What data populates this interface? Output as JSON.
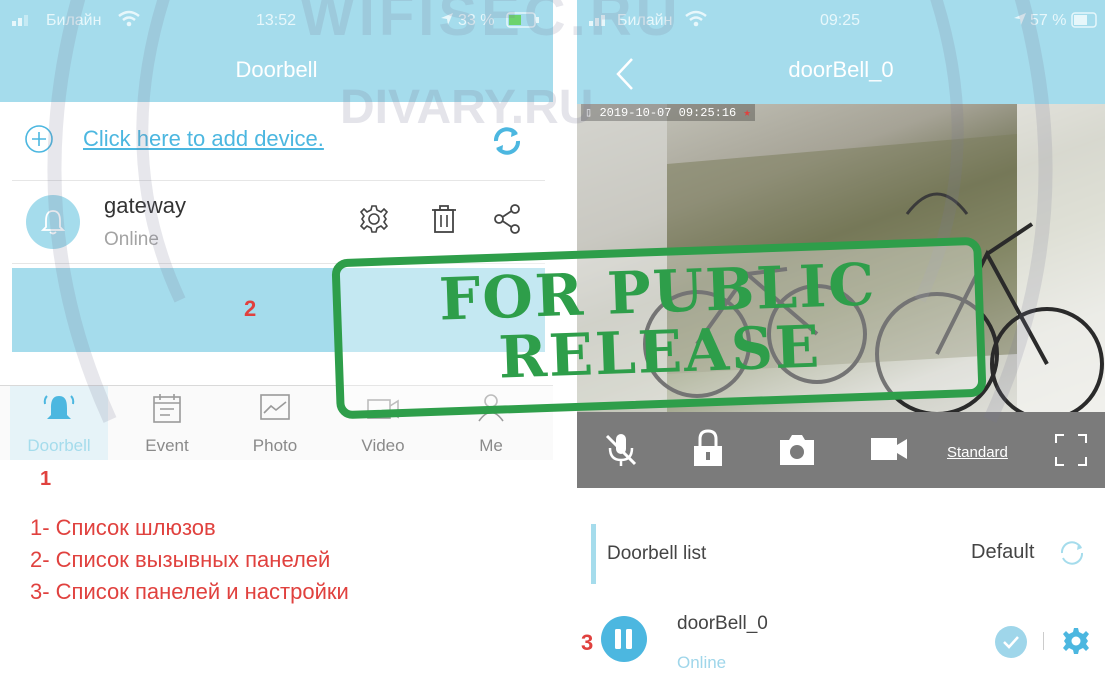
{
  "watermark": {
    "text_top": "WIFISEC.RU",
    "text_mid": "DIVARY.RU"
  },
  "stamp": {
    "line1": "FOR PUBLIC",
    "line2": "RELEASE"
  },
  "left": {
    "status": {
      "carrier": "Билайн",
      "time": "13:52",
      "battery": "33 %"
    },
    "title": "Doorbell",
    "add_link": "Click here to add device.",
    "gateway": {
      "name": "gateway",
      "status": "Online"
    },
    "panel_marker": "2",
    "tabs": [
      {
        "label": "Doorbell",
        "icon": "bell-icon"
      },
      {
        "label": "Event",
        "icon": "calendar-icon"
      },
      {
        "label": "Photo",
        "icon": "photo-icon"
      },
      {
        "label": "Video",
        "icon": "video-icon"
      },
      {
        "label": "Me",
        "icon": "user-icon"
      }
    ]
  },
  "legend": {
    "marker": "1",
    "items": [
      "1- Список шлюзов",
      "2- Список вызывных панелей",
      "3- Список панелей и настройки"
    ]
  },
  "right": {
    "status": {
      "carrier": "Билайн",
      "time": "09:25",
      "battery": "57 %"
    },
    "title": "doorBell_0",
    "overlay": {
      "timestamp": "2019-10-07  09:25:16"
    },
    "controls": {
      "quality": "Standard"
    },
    "list_title": "Doorbell list",
    "list_default": "Default",
    "device": {
      "name": "doorBell_0",
      "status": "Online",
      "marker": "3"
    }
  },
  "colors": {
    "header": "#a5dcec",
    "accent": "#4cb7e0",
    "stamp": "#2e9e4a",
    "marker": "#e0413e"
  }
}
